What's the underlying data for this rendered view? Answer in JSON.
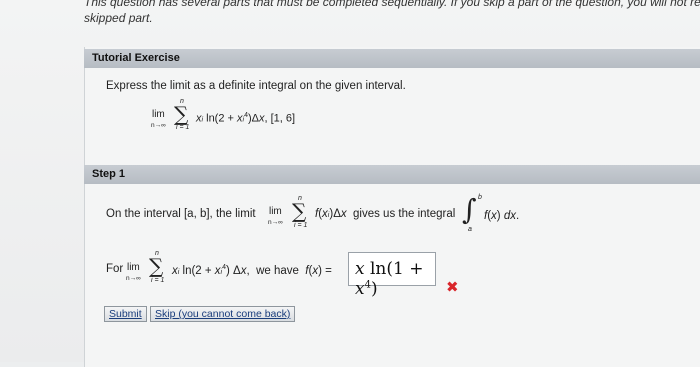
{
  "intro": {
    "line1": "This question has several parts that must be completed sequentially. If you skip a part of the question, you will not rec",
    "line2": "skipped part."
  },
  "tutorial": {
    "title": "Tutorial Exercise",
    "instruction": "Express the limit as a definite integral on the given interval.",
    "expression": "xi ln(2 + xi4)Δx, [1, 6]"
  },
  "step": {
    "title": "Step 1",
    "sentence_start": "On the interval [a, b], the limit",
    "sentence_mid": "f(xi)Δx  gives us the integral",
    "sentence_end": "f(x) dx.",
    "for_label": "For",
    "for_expr": "xi ln(2 + xi4) Δx,  we have  f(x) =",
    "answer": "x ln(1 + x4)"
  },
  "buttons": {
    "submit": "Submit",
    "skip": "Skip (you cannot come back)"
  },
  "status_colors": {
    "incorrect": "#d9262b"
  }
}
